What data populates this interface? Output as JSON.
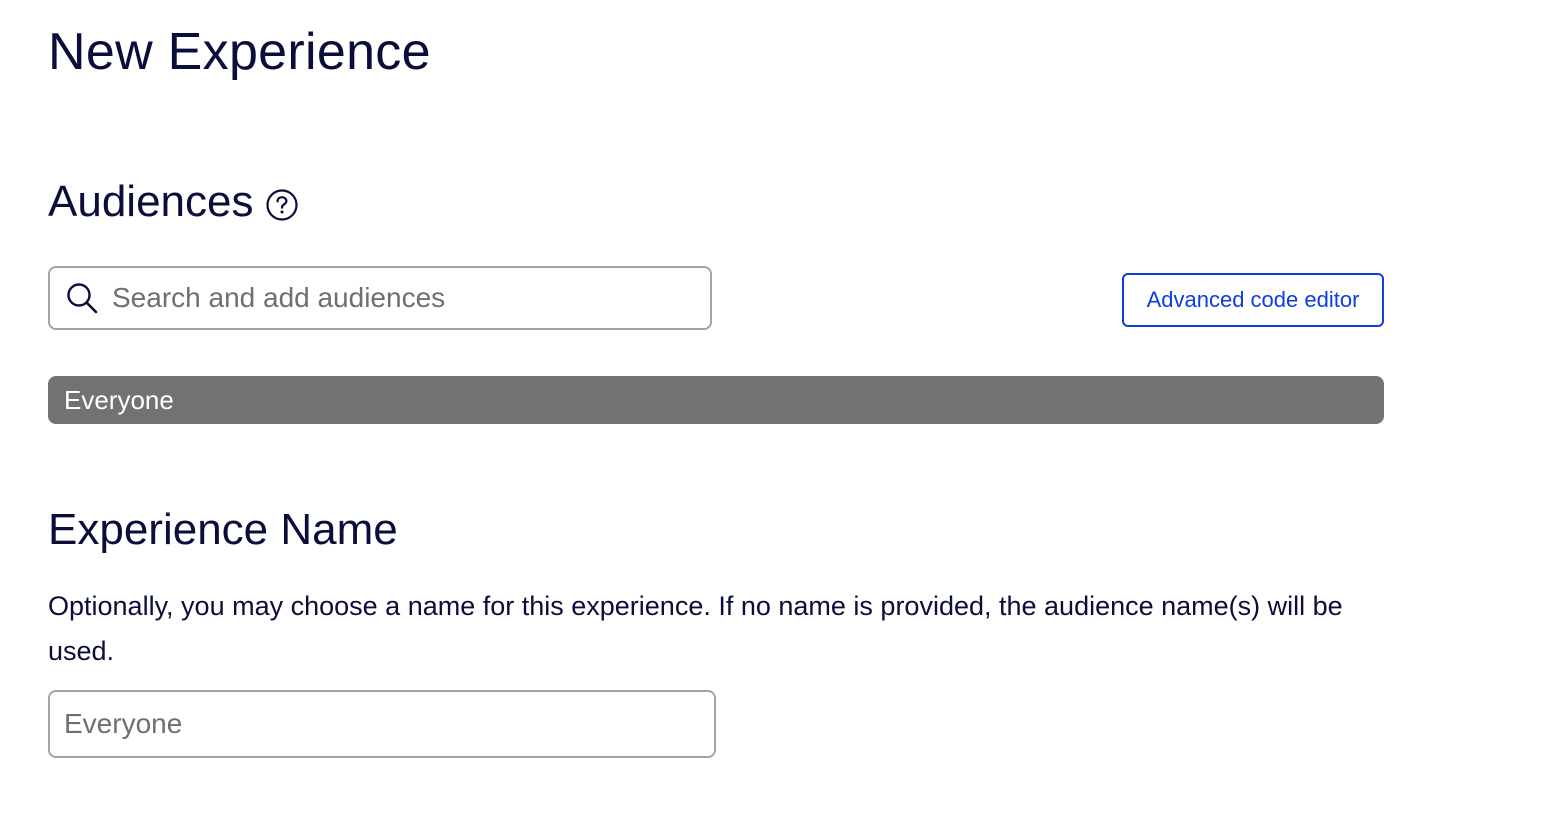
{
  "page": {
    "title": "New Experience"
  },
  "audiences": {
    "heading": "Audiences",
    "help_icon": "question-circle-icon",
    "search": {
      "icon": "search-icon",
      "placeholder": "Search and add audiences",
      "value": ""
    },
    "advanced_button_label": "Advanced code editor",
    "selected": [
      {
        "label": "Everyone"
      }
    ]
  },
  "experience_name": {
    "heading": "Experience Name",
    "description": "Optionally, you may choose a name for this experience. If no name is provided, the audience name(s) will be used.",
    "placeholder": "Everyone",
    "value": ""
  },
  "colors": {
    "text": "#0b0d3a",
    "link_blue": "#0b3fe0",
    "audience_bar": "#727272",
    "input_border": "#a4a4a8"
  }
}
